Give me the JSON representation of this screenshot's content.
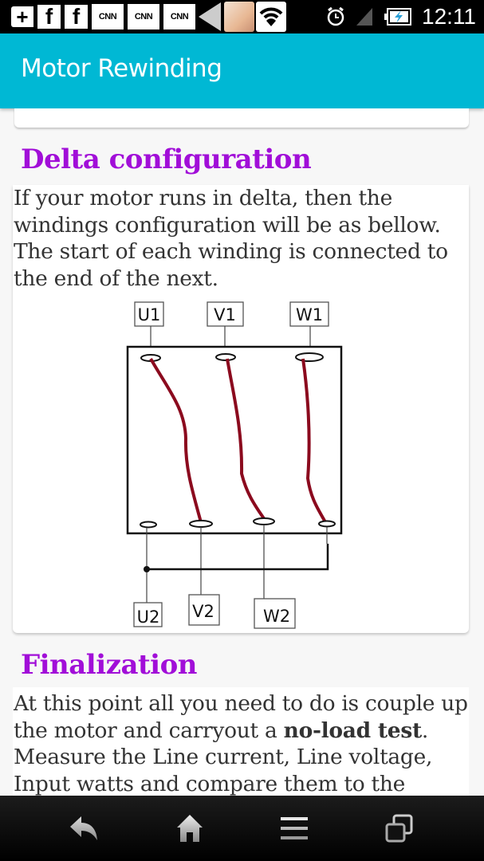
{
  "status_bar": {
    "notification_icons": [
      "add-icon",
      "facebook-icon",
      "facebook-icon",
      "cnn-icon",
      "cnn-icon",
      "cnn-icon",
      "back-arrow-icon",
      "photo-thumbnail-icon",
      "wifi-icon"
    ],
    "fb_glyph": "f",
    "plus_glyph": "+",
    "cnn_label": "CNN",
    "time": "12:11",
    "system_icons": [
      "alarm-icon",
      "signal-icon",
      "battery-charging-icon"
    ]
  },
  "app_bar": {
    "title": "Motor Rewinding"
  },
  "sections": [
    {
      "title": "Delta configuration",
      "body": "If your motor runs in delta, then the windings configuration will be as bellow. The start of each winding is connected to the end of the next.",
      "diagram": {
        "top_labels": [
          "U1",
          "V1",
          "W1"
        ],
        "bottom_labels": [
          "U2",
          "V2",
          "W2"
        ],
        "winding_color": "#8b0a1e"
      }
    },
    {
      "title": "Finalization",
      "body_parts": [
        {
          "text": "At this point all you need to do is couple up the motor and carryout a ",
          "bold": false
        },
        {
          "text": "no-load test",
          "bold": true
        },
        {
          "text": ". Measure the Line current, Line voltage, Input watts and compare them to the",
          "bold": false
        }
      ]
    }
  ],
  "nav_bar": {
    "buttons": [
      "back",
      "home",
      "menu",
      "recent-apps"
    ]
  },
  "colors": {
    "accent": "#00b8d4",
    "heading": "#a10ed8",
    "body_text": "#333333"
  }
}
